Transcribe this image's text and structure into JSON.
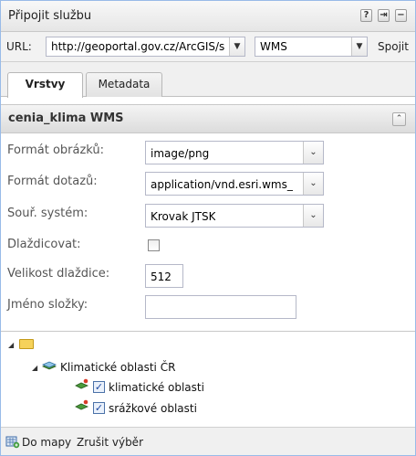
{
  "window": {
    "title": "Připojit službu",
    "tools": [
      "?",
      "⇥",
      "−"
    ]
  },
  "url_row": {
    "label": "URL:",
    "url_value": "http://geoportal.gov.cz/ArcGIS/s",
    "service_type": "WMS",
    "connect_label": "Spojit"
  },
  "tabs": [
    {
      "label": "Vrstvy",
      "active": true
    },
    {
      "label": "Metadata",
      "active": false
    }
  ],
  "service": {
    "title": "cenia_klima WMS"
  },
  "form": {
    "image_format_label": "Formát obrázků:",
    "image_format_value": "image/png",
    "query_format_label": "Formát dotazů:",
    "query_format_value": "application/vnd.esri.wms_",
    "crs_label": "Souř. systém:",
    "crs_value": "Krovak JTSK",
    "tiling_label": "Dlaždicovat:",
    "tiling_checked": false,
    "tile_size_label": "Velikost dlaždice:",
    "tile_size_value": "512",
    "folder_name_label": "Jméno složky:",
    "folder_name_value": ""
  },
  "tree": {
    "group_label": "Klimatické oblasti ČR",
    "layers": [
      {
        "label": "klimatické oblasti",
        "checked": true
      },
      {
        "label": "srážkové oblasti",
        "checked": true
      }
    ]
  },
  "bottom_bar": {
    "add_to_map": "Do mapy",
    "clear_selection": "Zrušit výběr"
  },
  "colors": {
    "border_accent": "#99bbe8",
    "folder": "#f6d25a",
    "checkbox_check": "#1c48a0"
  }
}
